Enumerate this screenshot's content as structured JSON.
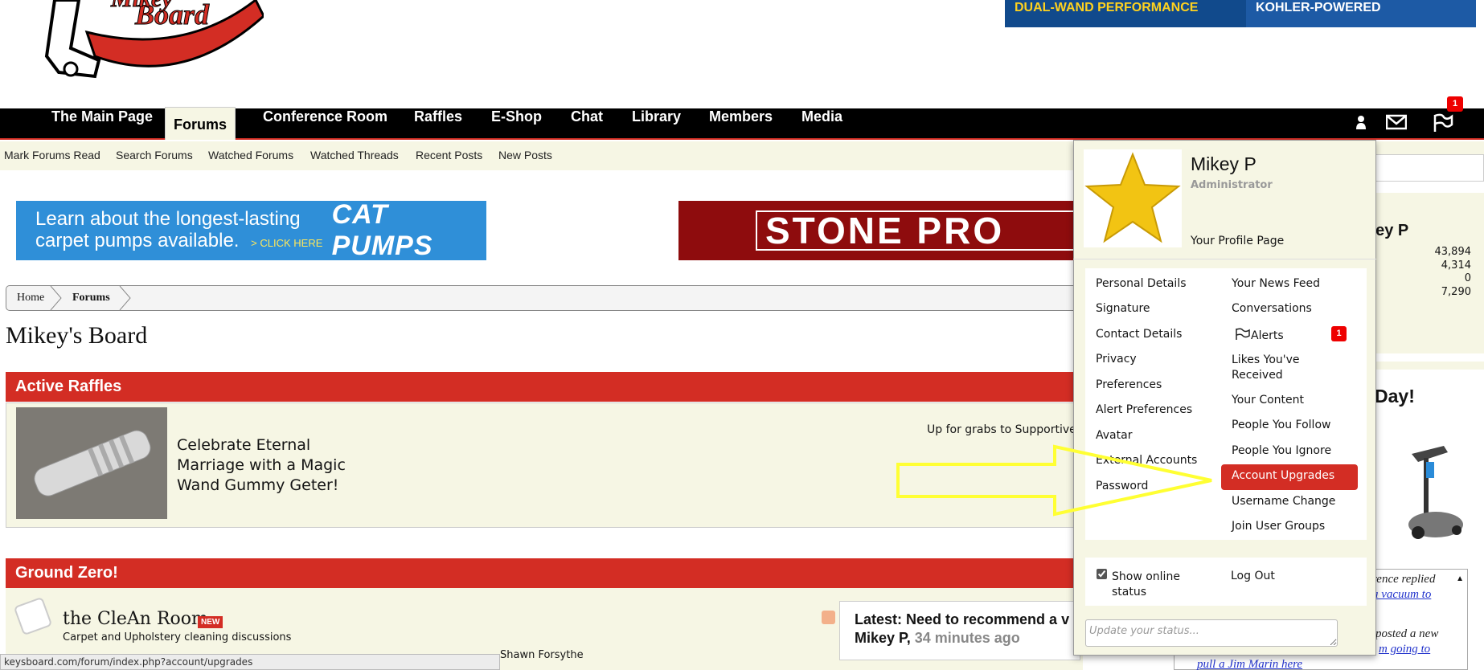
{
  "header": {
    "ad_left": "DUAL-WAND PERFORMANCE",
    "ad_right": "KOHLER-POWERED"
  },
  "nav": {
    "tabs": [
      "The Main Page",
      "Forums",
      "Conference Room",
      "Raffles",
      "E-Shop",
      "Chat",
      "Library",
      "Members",
      "Media"
    ],
    "active_tab": "Forums",
    "alert_count": "1",
    "icons": [
      "user-icon",
      "envelope-icon",
      "flag-icon"
    ]
  },
  "subnav": {
    "items": [
      "Mark Forums Read",
      "Search Forums",
      "Watched Forums",
      "Watched Threads",
      "Recent Posts",
      "New Posts"
    ]
  },
  "ads": {
    "cat_pumps_line1": "Learn about the longest-lasting",
    "cat_pumps_line2": "carpet pumps available.",
    "cat_pumps_cta": "> CLICK HERE",
    "cat_pumps_brand": "CAT PUMPS",
    "stone_pro": "STONE PRO"
  },
  "breadcrumb": [
    "Home",
    "Forums"
  ],
  "page_title": "Mikey's Board",
  "raffles": {
    "heading": "Active Raffles",
    "title": "Celebrate Eternal Marriage with a Magic Wand Gummy Geter!",
    "desc": "Up for grabs to Supportive..."
  },
  "ground_zero": {
    "heading": "Ground Zero!",
    "forum_name": "the CleAn Room",
    "new_badge": "NEW",
    "forum_desc": "Carpet and Upholstery cleaning discussions",
    "moderator": "Shawn Forsythe",
    "latest_title": "Latest: Need to recommend a v",
    "latest_user": "Mikey P,",
    "latest_time": "34 minutes ago"
  },
  "status_bar": "keysboard.com/forum/index.php?account/upgrades",
  "sidebar": {
    "name_fragment": "key P",
    "stats": [
      "43,894",
      "4,314",
      "0",
      "7,290"
    ],
    "day_fragment": "Day!",
    "feed_line1": "wrence replied",
    "feed_line2": "a vacuum to",
    "feed_line3": "posted a new",
    "feed_line4": "m going to",
    "feed_line5": "pull a Jim Marin here"
  },
  "popup": {
    "name": "Mikey P",
    "role": "Administrator",
    "profile_link": "Your Profile Page",
    "left_menu": [
      "Personal Details",
      "Signature",
      "Contact Details",
      "Privacy",
      "Preferences",
      "Alert Preferences",
      "Avatar",
      "External Accounts",
      "Password"
    ],
    "right_menu": [
      "Your News Feed",
      "Conversations",
      "Alerts",
      "Likes You've Received",
      "Your Content",
      "People You Follow",
      "People You Ignore",
      "Account Upgrades",
      "Username Change",
      "Join User Groups"
    ],
    "highlighted": "Account Upgrades",
    "alerts_badge": "1",
    "show_online": "Show online status",
    "logout": "Log Out",
    "status_placeholder": "Update your status..."
  },
  "colors": {
    "accent_red": "#d32d24",
    "nav_bg": "#000000",
    "panel_bg": "#f6f6e4",
    "annotation_arrow": "#ffff33"
  }
}
